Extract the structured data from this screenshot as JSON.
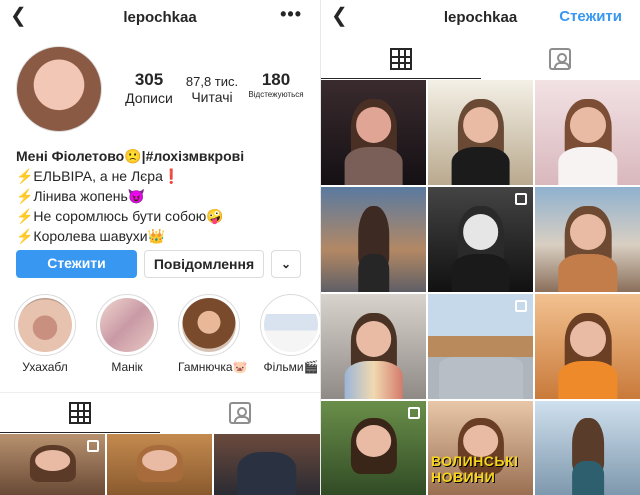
{
  "left": {
    "back_icon": "chevron-left-icon",
    "username": "lepochkaa",
    "more_icon": "ellipsis-icon",
    "more_glyph": "•••",
    "stats": {
      "posts": {
        "value": "305",
        "label": "Дописи"
      },
      "followers": {
        "value": "87,8 тис.",
        "label": "Читачі"
      },
      "following": {
        "value": "180",
        "label": "Відстежуються"
      }
    },
    "bio": [
      "Мені Фіолетово🙁|#лохізмвкрові",
      "⚡ЕЛЬВІРА, а не Лєра❗",
      "⚡Лінива жопень😈",
      "⚡Не соромлюсь бути собою🤪",
      "⚡Королева шавухи👑"
    ],
    "buttons": {
      "follow": "Стежити",
      "message": "Повідомлення",
      "dropdown": "⌄"
    },
    "highlights": [
      "Ухахабл",
      "Манік",
      "Гамнючка🐷",
      "Фільми🎬"
    ]
  },
  "right": {
    "back_icon": "chevron-left-icon",
    "username": "lepochkaa",
    "follow": "Стежити",
    "caption": "ВОЛИНСЬКІ НОВИНИ"
  },
  "colors": {
    "accent": "#3897f0",
    "text": "#262626",
    "border": "#dbdbdb"
  }
}
